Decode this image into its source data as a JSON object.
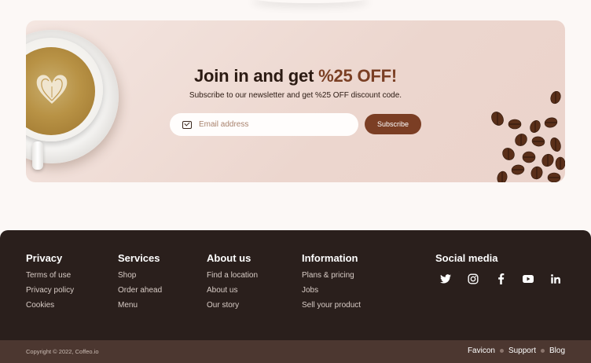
{
  "newsletter": {
    "title_prefix": "Join in and get ",
    "title_accent": "%25 OFF!",
    "subtitle": "Subscribe to our newsletter and get %25 OFF discount code.",
    "email_placeholder": "Email address",
    "subscribe_label": "Subscribe",
    "accent_color": "#7b3e24"
  },
  "footer": {
    "columns": [
      {
        "title": "Privacy",
        "links": [
          "Terms of use",
          "Privacy policy",
          "Cookies"
        ]
      },
      {
        "title": "Services",
        "links": [
          "Shop",
          "Order ahead",
          "Menu"
        ]
      },
      {
        "title": "About us",
        "links": [
          "Find a location",
          "About us",
          "Our story"
        ]
      },
      {
        "title": "Information",
        "links": [
          "Plans & pricing",
          "Jobs",
          "Sell your product"
        ]
      }
    ],
    "social": {
      "title": "Social media",
      "icons": [
        "twitter-icon",
        "instagram-icon",
        "facebook-icon",
        "youtube-icon",
        "linkedin-icon"
      ]
    },
    "copyright": "Copyright © 2022, Coffeo.io",
    "bottom_links": [
      "Favicon",
      "Support",
      "Blog"
    ]
  }
}
